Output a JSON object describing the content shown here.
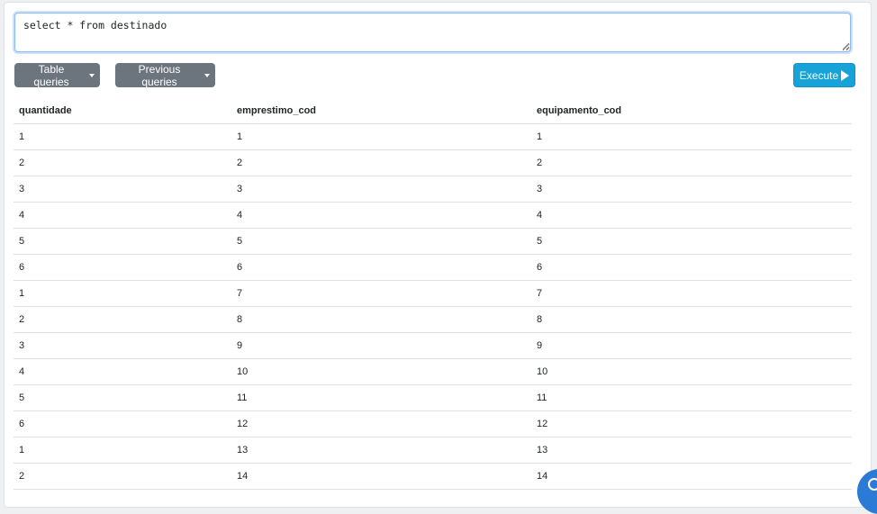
{
  "query": {
    "text": "select * from destinado"
  },
  "toolbar": {
    "table_queries_label": "Table queries",
    "previous_queries_label": "Previous queries",
    "execute_label": "Execute"
  },
  "colors": {
    "execute_button": "#17a2d8",
    "dropdown_button": "#6c757d",
    "help_button": "#2b7bd6"
  },
  "results": {
    "columns": [
      "quantidade",
      "emprestimo_cod",
      "equipamento_cod"
    ],
    "rows": [
      [
        "1",
        "1",
        "1"
      ],
      [
        "2",
        "2",
        "2"
      ],
      [
        "3",
        "3",
        "3"
      ],
      [
        "4",
        "4",
        "4"
      ],
      [
        "5",
        "5",
        "5"
      ],
      [
        "6",
        "6",
        "6"
      ],
      [
        "1",
        "7",
        "7"
      ],
      [
        "2",
        "8",
        "8"
      ],
      [
        "3",
        "9",
        "9"
      ],
      [
        "4",
        "10",
        "10"
      ],
      [
        "5",
        "11",
        "11"
      ],
      [
        "6",
        "12",
        "12"
      ],
      [
        "1",
        "13",
        "13"
      ],
      [
        "2",
        "14",
        "14"
      ]
    ]
  },
  "help": {
    "icon": "chat-help-icon"
  }
}
